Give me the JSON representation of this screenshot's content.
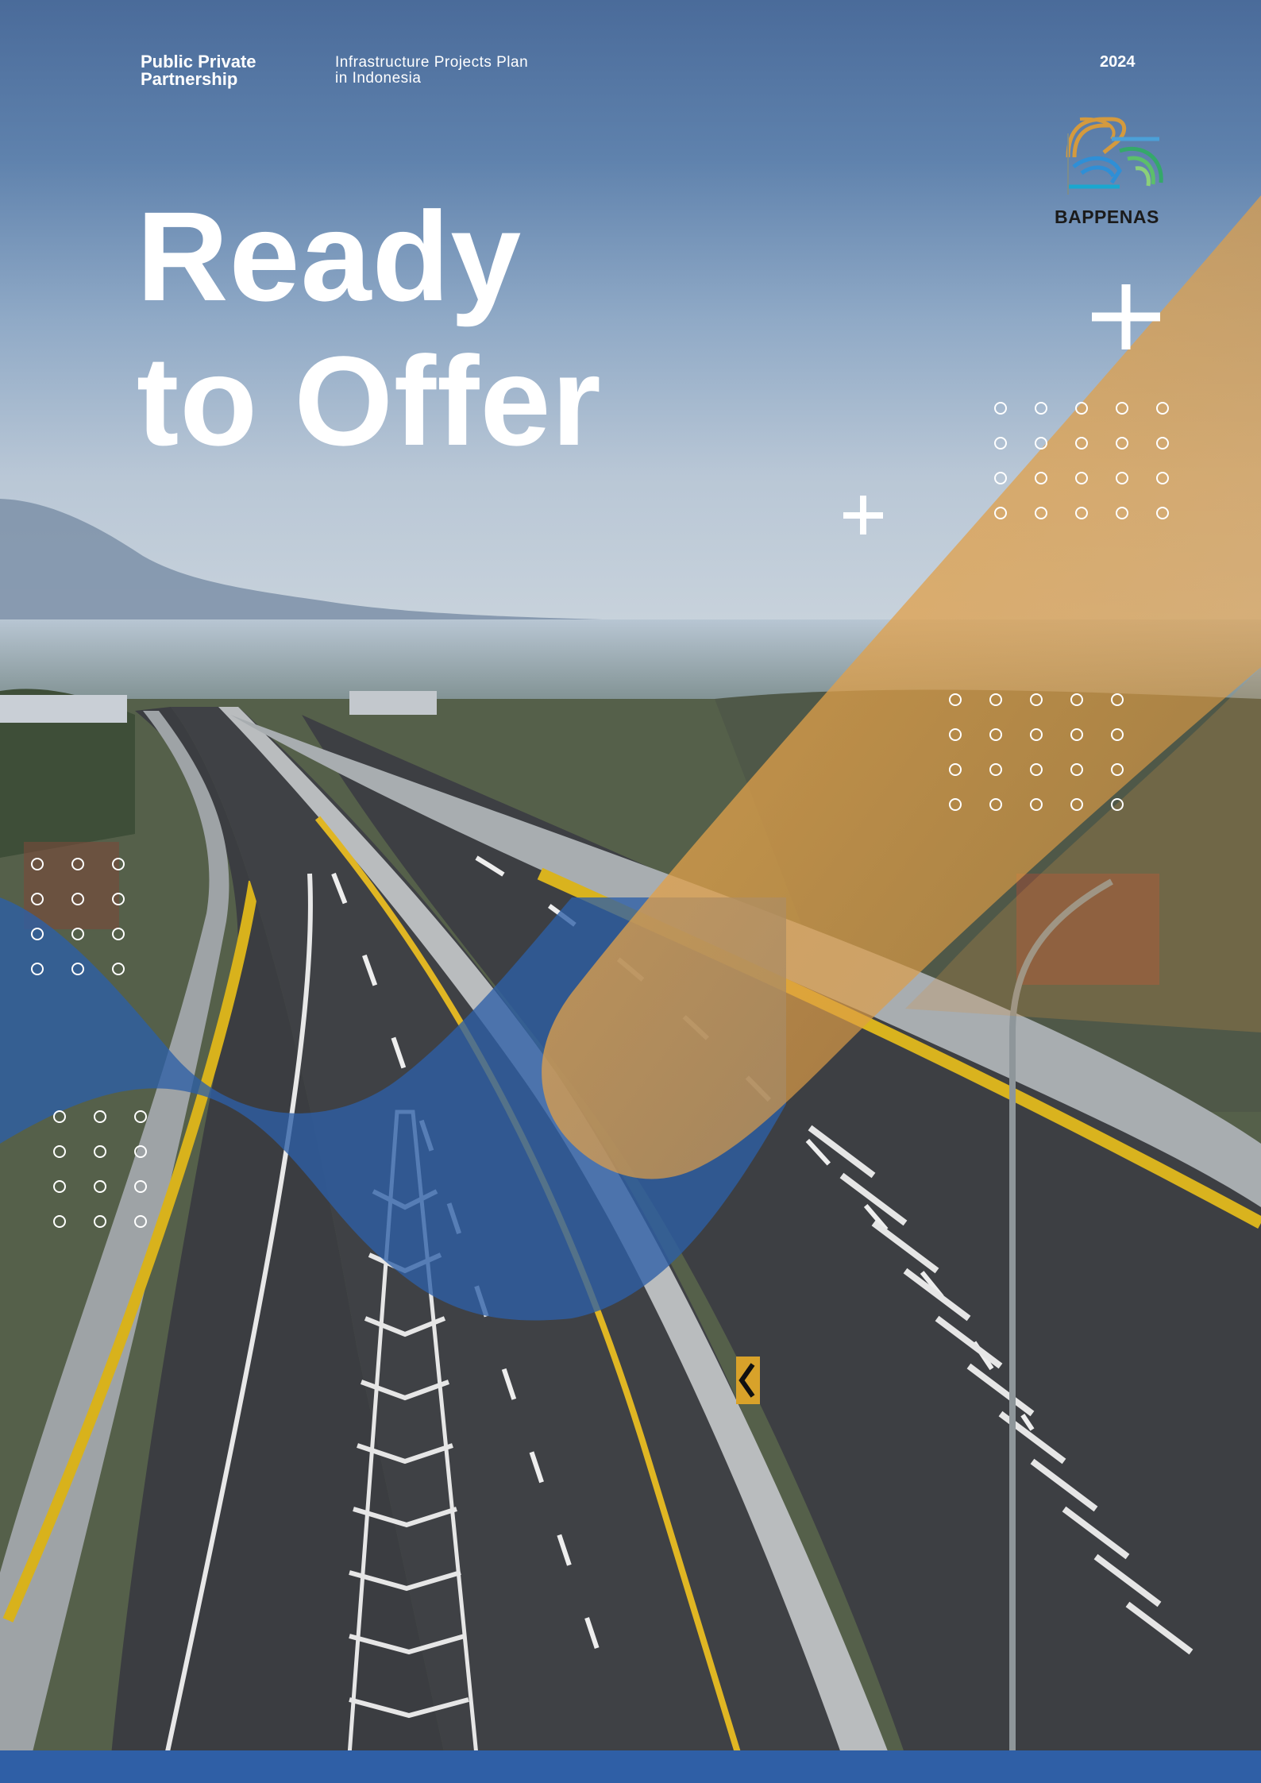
{
  "header": {
    "program": "Public Private\nPartnership",
    "subtitle": "Infrastructure Projects Plan\nin Indonesia",
    "year": "2024"
  },
  "headline": "Ready\nto Offer",
  "logo": {
    "text": "BAPPENAS",
    "icon": "bappenas-logo-icon"
  },
  "decorations": {
    "plus_icon": "plus-icon",
    "dot_grid_icon": "dot-grid-icon",
    "shape_colors": {
      "orange": "#e4a04c",
      "blue": "#2d5fa7"
    }
  },
  "palette": {
    "footer_bar": "#2f5fa6",
    "sky_top": "#4a6d9c",
    "road": "#3c3e42"
  }
}
